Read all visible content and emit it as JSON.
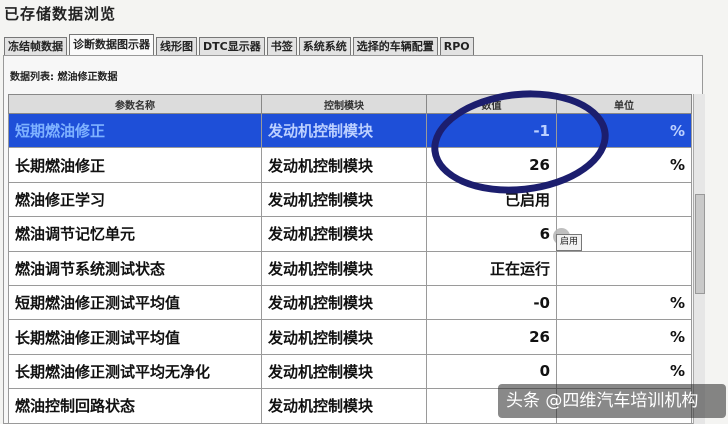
{
  "window": {
    "title": "已存储数据浏览"
  },
  "tabs": [
    {
      "label": "冻结帧数据",
      "active": false
    },
    {
      "label": "诊断数据图示器",
      "active": true
    },
    {
      "label": "线形图",
      "active": false
    },
    {
      "label": "DTC显示器",
      "active": false
    },
    {
      "label": "书签",
      "active": false
    },
    {
      "label": "系统系统",
      "active": false
    },
    {
      "label": "选择的车辆配置",
      "active": false
    },
    {
      "label": "RPO",
      "active": false
    }
  ],
  "panel": {
    "label": "数据列表: 燃油修正数据"
  },
  "table": {
    "headers": [
      "参数名称",
      "控制模块",
      "数值",
      "单位"
    ],
    "rows": [
      {
        "name": "短期燃油修正",
        "module": "发动机控制模块",
        "value": "-1",
        "unit": "%",
        "selected": true
      },
      {
        "name": "长期燃油修正",
        "module": "发动机控制模块",
        "value": "26",
        "unit": "%"
      },
      {
        "name": "燃油修正学习",
        "module": "发动机控制模块",
        "value": "已启用",
        "unit": ""
      },
      {
        "name": "燃油调节记忆单元",
        "module": "发动机控制模块",
        "value": "6",
        "unit": ""
      },
      {
        "name": "燃油调节系统测试状态",
        "module": "发动机控制模块",
        "value": "正在运行",
        "unit": ""
      },
      {
        "name": "短期燃油修正测试平均值",
        "module": "发动机控制模块",
        "value": "-0",
        "unit": "%"
      },
      {
        "name": "长期燃油修正测试平均值",
        "module": "发动机控制模块",
        "value": "26",
        "unit": "%"
      },
      {
        "name": "长期燃油修正测试平均无净化",
        "module": "发动机控制模块",
        "value": "0",
        "unit": "%"
      },
      {
        "name": "燃油控制回路状态",
        "module": "发动机控制模块",
        "value": "",
        "unit": ""
      }
    ]
  },
  "mini_button": {
    "label": "启用"
  },
  "watermark": {
    "text": "头条 @四维汽车培训机构"
  },
  "colors": {
    "selection": "#1e4fd8",
    "ring": "#1c1e6e"
  }
}
